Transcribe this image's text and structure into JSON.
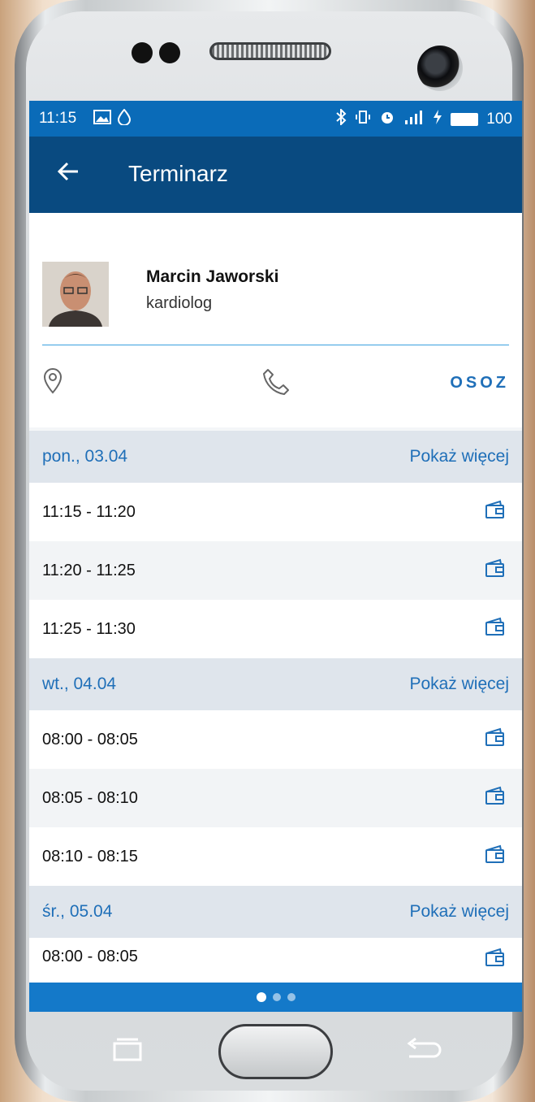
{
  "status_bar": {
    "time": "11:15",
    "battery": "100",
    "icons_left": [
      "image-icon",
      "drop-icon"
    ],
    "icons_right": [
      "bluetooth-icon",
      "vibrate-icon",
      "alarm-icon",
      "signal-4g-icon",
      "charging-icon",
      "battery-icon"
    ]
  },
  "app_bar": {
    "title": "Terminarz",
    "back_icon": "arrow-left-icon"
  },
  "doctor": {
    "name": "Marcin Jaworski",
    "specialty": "kardiolog"
  },
  "actions": {
    "location_icon": "location-pin-icon",
    "phone_icon": "phone-icon",
    "osoz_label": "OSOZ"
  },
  "days": [
    {
      "date": "pon., 03.04",
      "more": "Pokaż więcej",
      "slots": [
        "11:15 - 11:20",
        "11:20 - 11:25",
        "11:25 - 11:30"
      ]
    },
    {
      "date": "wt., 04.04",
      "more": "Pokaż więcej",
      "slots": [
        "08:00 - 08:05",
        "08:05 - 08:10",
        "08:10 - 08:15"
      ]
    },
    {
      "date": "śr., 05.04",
      "more": "Pokaż więcej",
      "slots": [
        "08:00 - 08:05"
      ]
    }
  ],
  "colors": {
    "app_bar": "#094a80",
    "status_bar": "#0a6bb8",
    "accent": "#1f6fb8",
    "day_header_bg": "#dfe5ec"
  },
  "pager": {
    "pages": 3,
    "active": 1
  }
}
